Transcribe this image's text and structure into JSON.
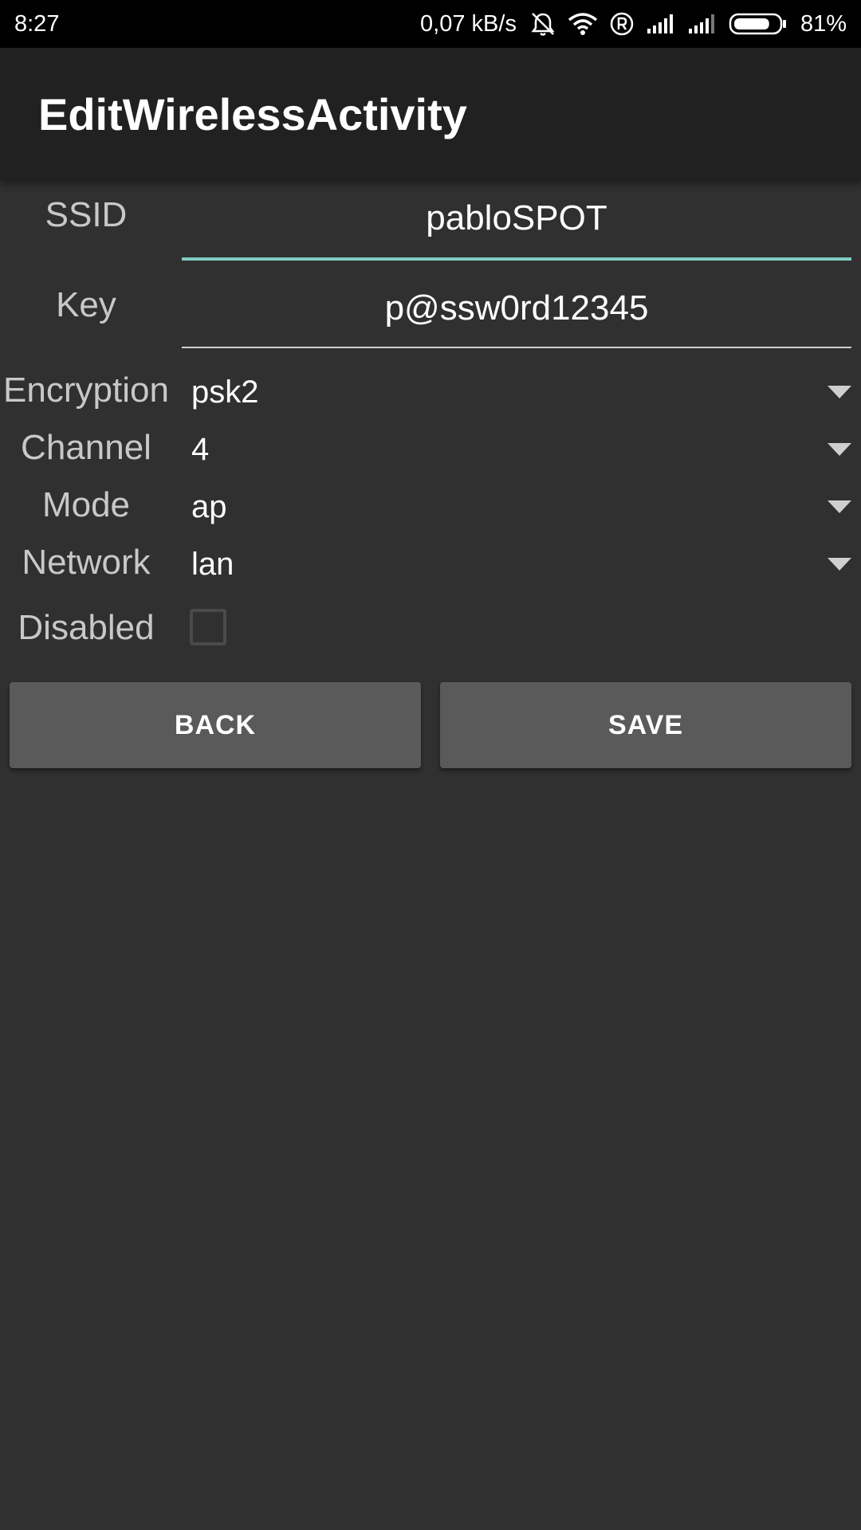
{
  "status_bar": {
    "time": "8:27",
    "net_speed": "0,07 kB/s",
    "battery_percent": "81%",
    "battery_level": 0.81,
    "icons": [
      "alarm-off-icon",
      "wifi-icon",
      "roaming-icon",
      "signal-icon",
      "signal-icon",
      "battery-icon"
    ]
  },
  "action_bar": {
    "title": "EditWirelessActivity"
  },
  "form": {
    "ssid": {
      "label": "SSID",
      "value": "pabloSPOT"
    },
    "key": {
      "label": "Key",
      "value": "p@ssw0rd12345"
    },
    "encryption": {
      "label": "Encryption",
      "value": "psk2"
    },
    "channel": {
      "label": "Channel",
      "value": "4"
    },
    "mode": {
      "label": "Mode",
      "value": "ap"
    },
    "network": {
      "label": "Network",
      "value": "lan"
    },
    "disabled": {
      "label": "Disabled",
      "checked": false
    }
  },
  "buttons": {
    "back": "BACK",
    "save": "SAVE"
  },
  "colors": {
    "background": "#303030",
    "action_bar": "#212121",
    "accent": "#80cbc4",
    "button": "#5a5a5b"
  }
}
